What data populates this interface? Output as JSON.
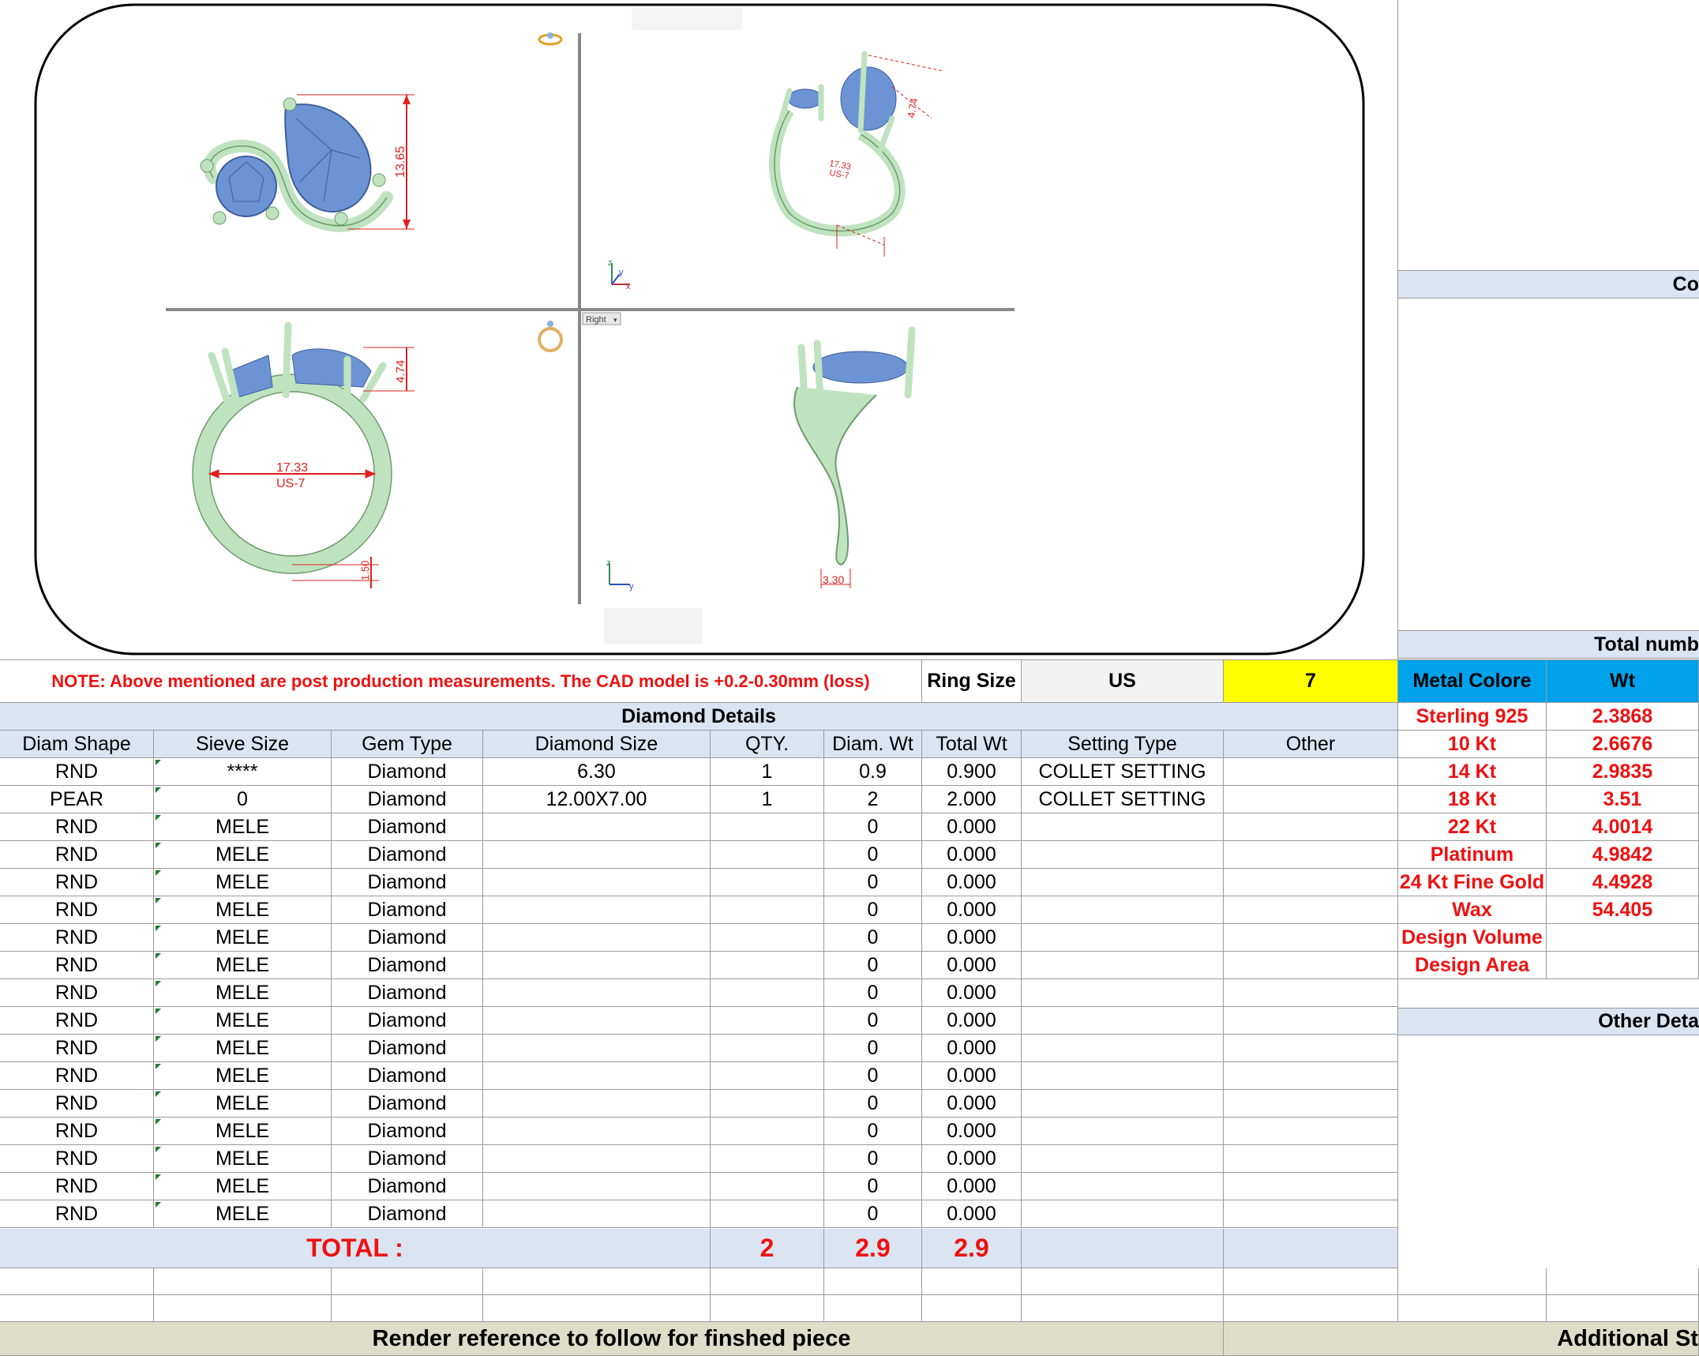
{
  "viewport": {
    "dim_height_top": "13.65",
    "dim_top_right_a": "4.74",
    "dim_top_right_b": "17.33",
    "dim_top_right_c": "US-7",
    "dim_front_height": "4.74",
    "dim_front_width": "17.33",
    "dim_front_size": "US-7",
    "dim_front_band": "1.50",
    "dim_side_band": "3.30",
    "view_label": "Right",
    "axis_x": "x",
    "axis_y": "y",
    "axis_z": "z"
  },
  "note": {
    "text": "NOTE: Above mentioned are post production measurements. The CAD model is +0.2-0.30mm (loss)",
    "ring_size_label": "Ring Size",
    "ring_size_system": "US",
    "ring_size_value": "7"
  },
  "diamond_details": {
    "title": "Diamond Details",
    "columns": [
      "Diam Shape",
      "Sieve Size",
      "Gem Type",
      "Diamond Size",
      "QTY.",
      "Diam. Wt",
      "Total Wt",
      "Setting Type",
      "Other"
    ],
    "rows": [
      [
        "RND",
        "****",
        "Diamond",
        "6.30",
        "1",
        "0.9",
        "0.900",
        "COLLET SETTING",
        ""
      ],
      [
        "PEAR",
        "0",
        "Diamond",
        "12.00X7.00",
        "1",
        "2",
        "2.000",
        "COLLET SETTING",
        ""
      ],
      [
        "RND",
        "MELE",
        "Diamond",
        "",
        "",
        "0",
        "0.000",
        "",
        ""
      ],
      [
        "RND",
        "MELE",
        "Diamond",
        "",
        "",
        "0",
        "0.000",
        "",
        ""
      ],
      [
        "RND",
        "MELE",
        "Diamond",
        "",
        "",
        "0",
        "0.000",
        "",
        ""
      ],
      [
        "RND",
        "MELE",
        "Diamond",
        "",
        "",
        "0",
        "0.000",
        "",
        ""
      ],
      [
        "RND",
        "MELE",
        "Diamond",
        "",
        "",
        "0",
        "0.000",
        "",
        ""
      ],
      [
        "RND",
        "MELE",
        "Diamond",
        "",
        "",
        "0",
        "0.000",
        "",
        ""
      ],
      [
        "RND",
        "MELE",
        "Diamond",
        "",
        "",
        "0",
        "0.000",
        "",
        ""
      ],
      [
        "RND",
        "MELE",
        "Diamond",
        "",
        "",
        "0",
        "0.000",
        "",
        ""
      ],
      [
        "RND",
        "MELE",
        "Diamond",
        "",
        "",
        "0",
        "0.000",
        "",
        ""
      ],
      [
        "RND",
        "MELE",
        "Diamond",
        "",
        "",
        "0",
        "0.000",
        "",
        ""
      ],
      [
        "RND",
        "MELE",
        "Diamond",
        "",
        "",
        "0",
        "0.000",
        "",
        ""
      ],
      [
        "RND",
        "MELE",
        "Diamond",
        "",
        "",
        "0",
        "0.000",
        "",
        ""
      ],
      [
        "RND",
        "MELE",
        "Diamond",
        "",
        "",
        "0",
        "0.000",
        "",
        ""
      ],
      [
        "RND",
        "MELE",
        "Diamond",
        "",
        "",
        "0",
        "0.000",
        "",
        ""
      ],
      [
        "RND",
        "MELE",
        "Diamond",
        "",
        "",
        "0",
        "0.000",
        "",
        ""
      ]
    ],
    "total_label": "TOTAL :",
    "total_qty": "2",
    "total_diam_wt": "2.9",
    "total_wt": "2.9"
  },
  "right_panel": {
    "header_top": "Co",
    "total_number": "Total numb",
    "metal_header": "Metal Colore",
    "wt_header": "Wt",
    "metals": [
      {
        "name": "Sterling 925",
        "wt": "2.3868"
      },
      {
        "name": "10 Kt",
        "wt": "2.6676"
      },
      {
        "name": "14 Kt",
        "wt": "2.9835"
      },
      {
        "name": "18 Kt",
        "wt": "3.51"
      },
      {
        "name": "22 Kt",
        "wt": "4.0014"
      },
      {
        "name": "Platinum",
        "wt": "4.9842"
      },
      {
        "name": "24 Kt Fine Gold",
        "wt": "4.4928"
      },
      {
        "name": "Wax",
        "wt": "54.405"
      },
      {
        "name": "Design Volume",
        "wt": ""
      },
      {
        "name": "Design Area",
        "wt": ""
      }
    ],
    "other_details": "Other Deta"
  },
  "footer": {
    "render_reference": "Render reference to follow for finshed piece",
    "additional": "Additional St"
  },
  "colors": {
    "header_fill": "#dbe5f1",
    "ring_metal": "#bfe3bf",
    "gem_blue": "#6c94d4",
    "ring_size_highlight": "#ffff00",
    "metal_header_fill": "#00a2ec",
    "red_text": "#ee1111"
  }
}
